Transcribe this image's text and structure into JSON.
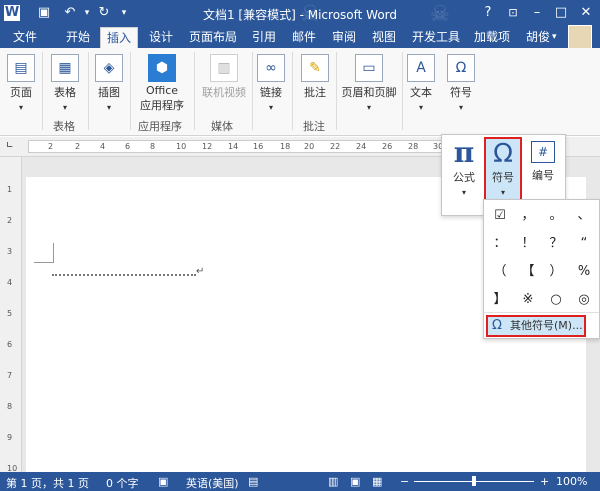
{
  "titlebar": {
    "title": "文档1 [兼容模式] - Microsoft Word",
    "icons": [
      "word-icon",
      "save-icon",
      "undo-icon",
      "redo-icon"
    ],
    "help": "?",
    "window_controls": [
      "restore-ribbon",
      "minimize",
      "maximize",
      "close"
    ]
  },
  "tabs": {
    "file": "文件",
    "items": [
      "开始",
      "插入",
      "设计",
      "页面布局",
      "引用",
      "邮件",
      "审阅",
      "视图",
      "开发工具",
      "加载项"
    ],
    "active": "插入",
    "user": "胡俊"
  },
  "ribbon": {
    "pages": "页面",
    "table": "表格",
    "table_group": "表格",
    "illustration": "插图",
    "office_line1": "Office",
    "office_line2": "应用程序",
    "apps_group": "应用程序",
    "online_video": "联机视频",
    "media_group": "媒体",
    "links": "链接",
    "comment": "批注",
    "comment_group": "批注",
    "header_footer": "页眉和页脚",
    "text": "文本",
    "symbols": "符号"
  },
  "ruler": {
    "marks": [
      "2",
      "2",
      "4",
      "6",
      "8",
      "10",
      "12",
      "14",
      "16",
      "18",
      "20",
      "22",
      "24",
      "26",
      "28",
      "30"
    ],
    "vmarks": [
      "1",
      "2",
      "3",
      "4",
      "5",
      "6",
      "7",
      "8",
      "9",
      "10"
    ]
  },
  "symbol_panel": {
    "formula": "公式",
    "symbol": "符号",
    "numbering": "编号"
  },
  "gallery": {
    "symbols": [
      "☑",
      "，",
      "。",
      "、",
      "：",
      "！",
      "？",
      "“",
      "（",
      "【",
      "）",
      "%",
      "】",
      "※",
      "○",
      "◎"
    ],
    "more": "其他符号(M)..."
  },
  "status": {
    "page": "第 1 页，共 1 页",
    "words": "0 个字",
    "language": "英语(美国)",
    "zoom": "100%",
    "zoom_level": 1.0
  },
  "colors": {
    "accent": "#2b579a",
    "highlight": "#cde6f7",
    "callout": "#e02020"
  }
}
